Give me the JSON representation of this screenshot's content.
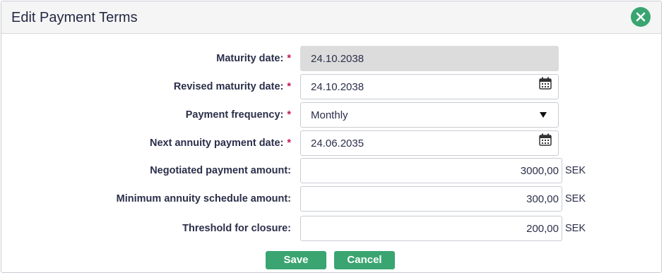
{
  "dialog": {
    "title": "Edit Payment Terms",
    "close_icon": "close-circle-icon",
    "accent_color": "#3aa571",
    "required_mark": "*"
  },
  "fields": {
    "maturity_date": {
      "label": "Maturity date:",
      "value": "24.10.2038",
      "required": true,
      "readonly": true
    },
    "revised_maturity_date": {
      "label": "Revised maturity date:",
      "value": "24.10.2038",
      "required": true,
      "icon": "calendar-icon"
    },
    "payment_frequency": {
      "label": "Payment frequency:",
      "value": "Monthly",
      "required": true,
      "icon": "dropdown-arrow-icon"
    },
    "next_annuity_payment_date": {
      "label": "Next annuity payment date:",
      "value": "24.06.2035",
      "required": true,
      "icon": "calendar-icon"
    },
    "negotiated_payment_amount": {
      "label": "Negotiated payment amount:",
      "value": "3000,00",
      "unit": "SEK"
    },
    "minimum_annuity_schedule_amount": {
      "label": "Minimum annuity schedule amount:",
      "value": "300,00",
      "unit": "SEK"
    },
    "threshold_for_closure": {
      "label": "Threshold for closure:",
      "value": "200,00",
      "unit": "SEK"
    }
  },
  "buttons": {
    "save_label": "Save",
    "cancel_label": "Cancel"
  }
}
